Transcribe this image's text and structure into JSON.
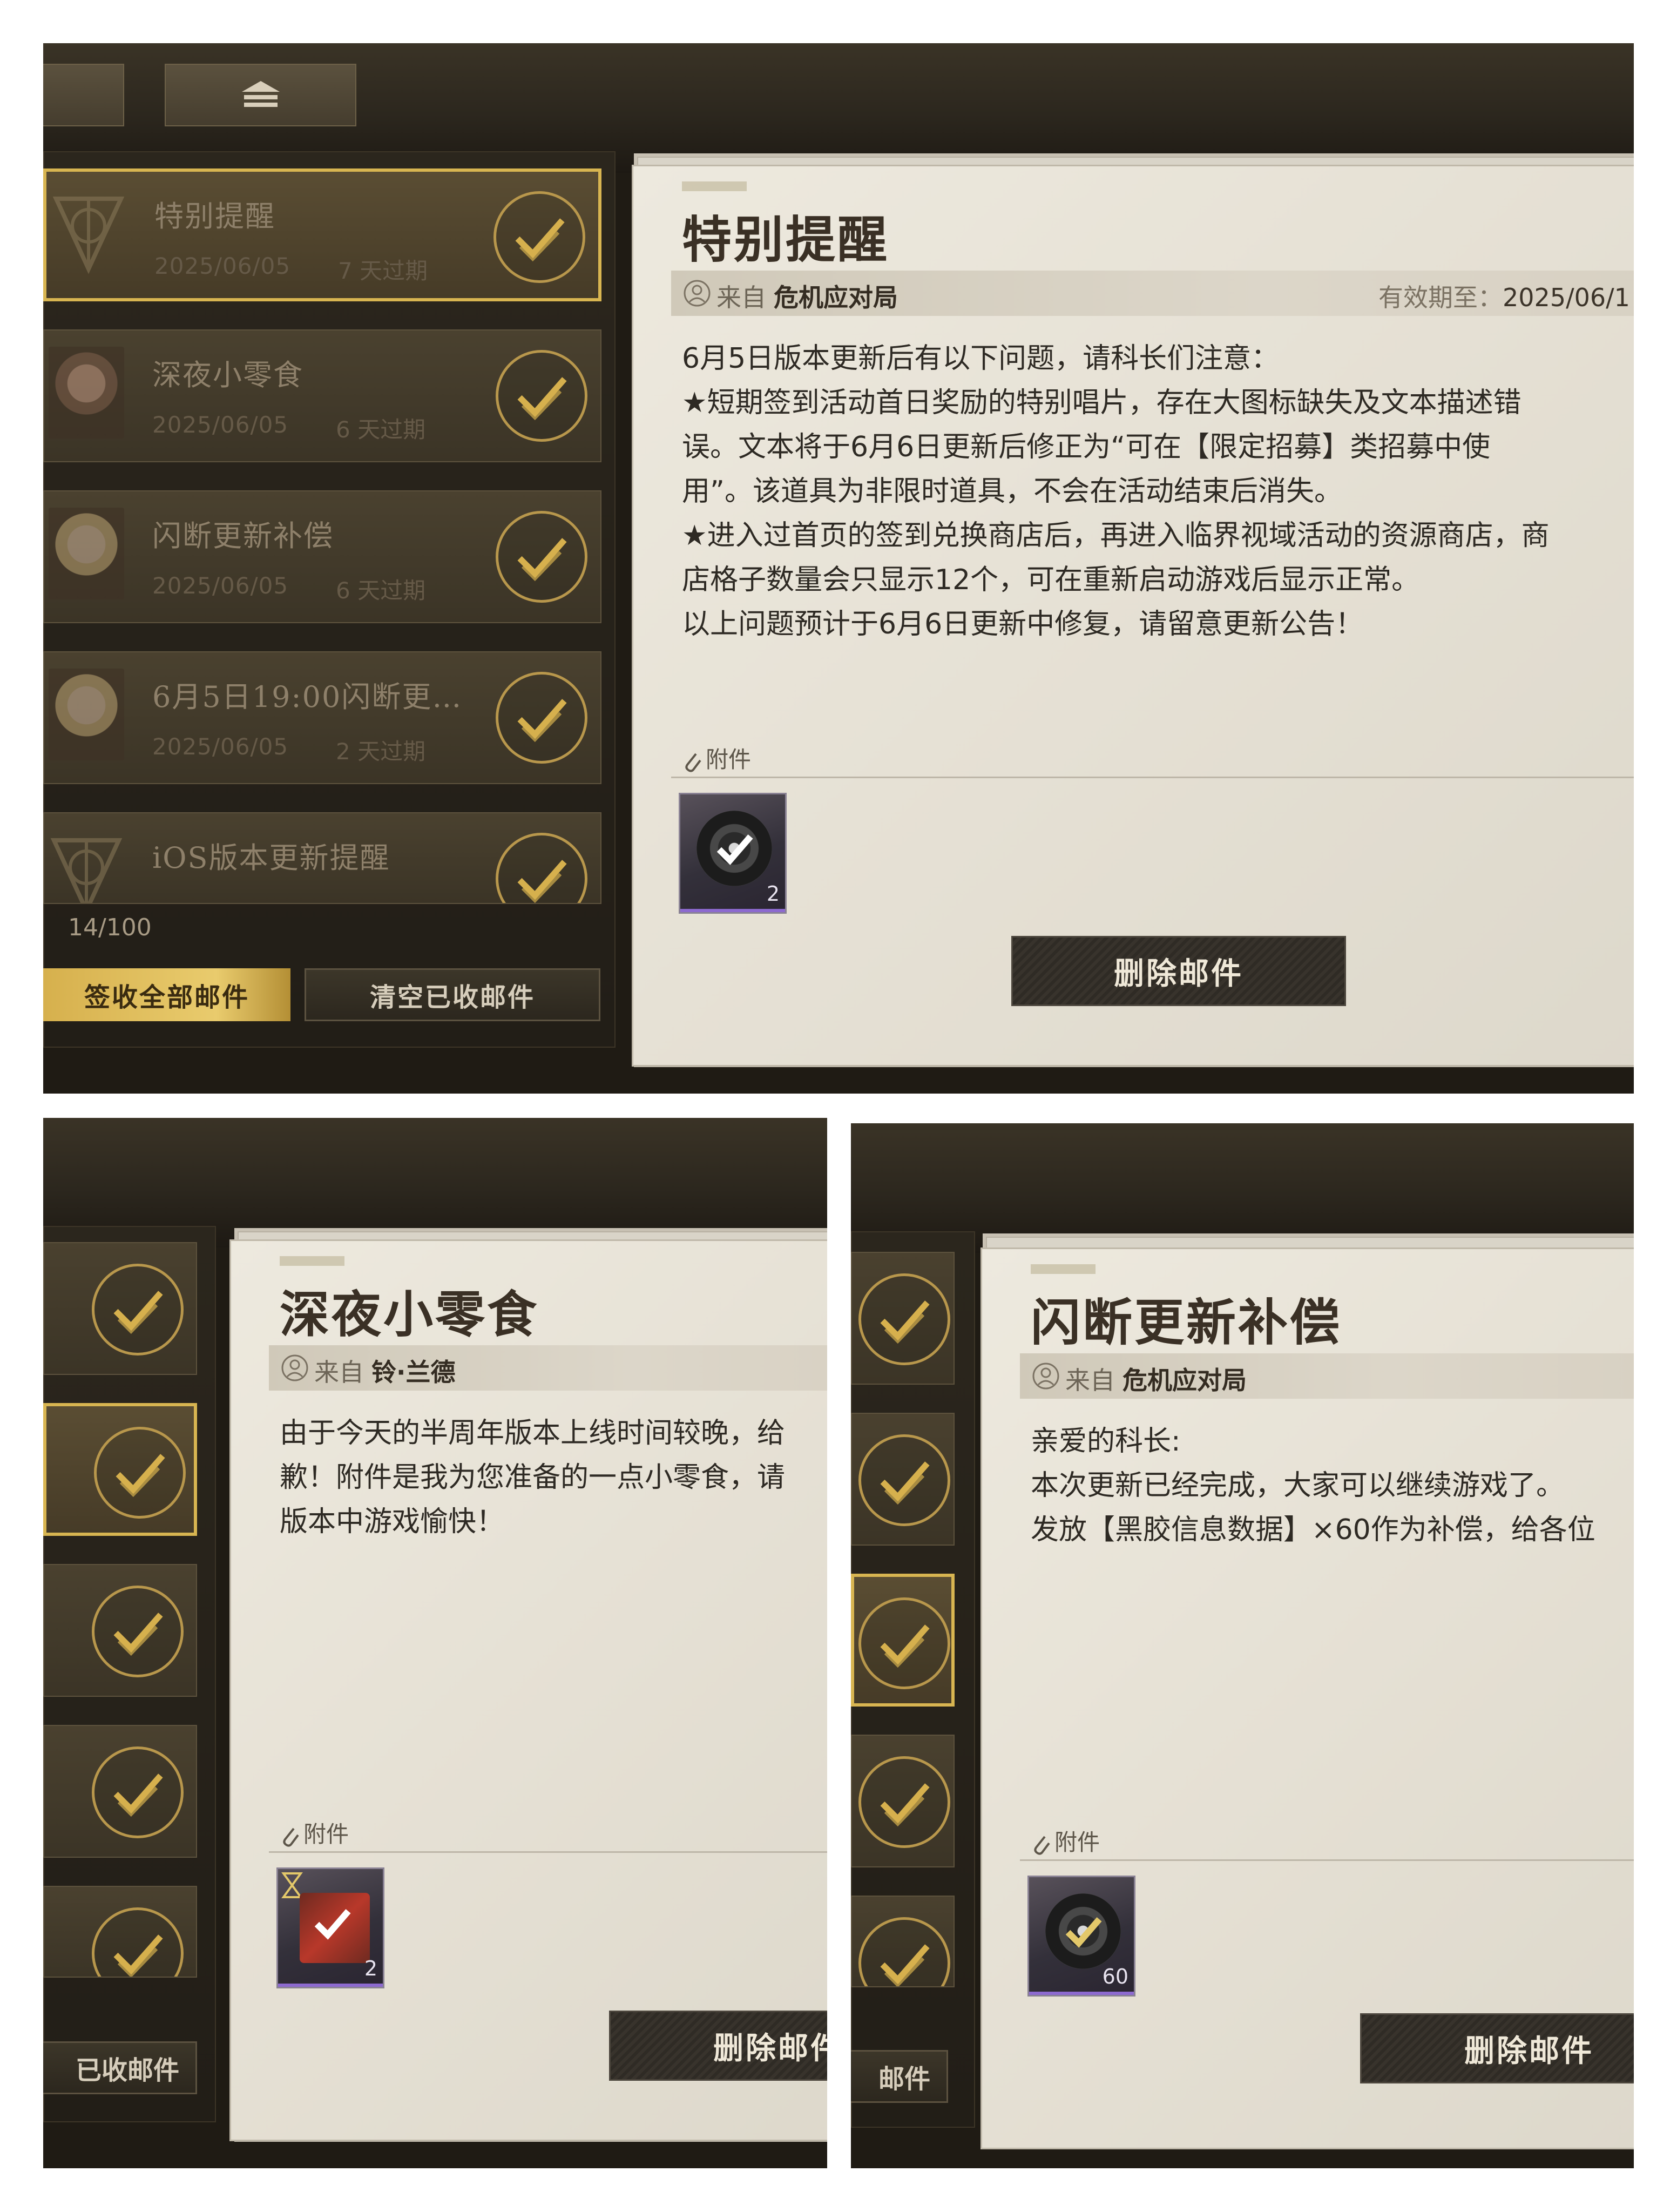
{
  "panels": [
    {
      "mail_list": [
        {
          "title": "特别提醒",
          "date": "2025/06/05",
          "expire": "7 天过期",
          "avatar": "emblem-icon",
          "selected": true
        },
        {
          "title": "深夜小零食",
          "date": "2025/06/05",
          "expire": "6 天过期",
          "avatar": "character-avatar",
          "selected": false
        },
        {
          "title": "闪断更新补偿",
          "date": "2025/06/05",
          "expire": "6 天过期",
          "avatar": "character-avatar",
          "selected": false
        },
        {
          "title": "6月5日19:00闪断更…",
          "date": "2025/06/05",
          "expire": "2 天过期",
          "avatar": "character-avatar",
          "selected": false
        },
        {
          "title": "iOS版本更新提醒",
          "date": "",
          "expire": "",
          "avatar": "emblem-icon",
          "selected": false
        }
      ],
      "counter": "14/100",
      "claim_all": "签收全部邮件",
      "clear_received": "清空已收邮件",
      "detail": {
        "title": "特别提醒",
        "from_label": "来自",
        "from_name": "危机应对局",
        "valid_label": "有效期至：",
        "valid_value": "2025/06/1",
        "body": [
          "6月5日版本更新后有以下问题，请科长们注意：",
          "★短期签到活动首日奖励的特别唱片，存在大图标缺失及文本描述错",
          "误。文本将于6月6日更新后修正为“可在【限定招募】类招募中使",
          "用”。该道具为非限时道具，不会在活动结束后消失。",
          "★进入过首页的签到兑换商店后，再进入临界视域活动的资源商店，商",
          "店格子数量会只显示12个，可在重新启动游戏后显示正常。",
          "以上问题预计于6月6日更新中修复，请留意更新公告！"
        ],
        "attachment_label": "附件",
        "attachment_qty": "2",
        "delete": "删除邮件"
      }
    },
    {
      "detail": {
        "title": "深夜小零食",
        "from_label": "来自",
        "from_name": "铃·兰德",
        "body": [
          "由于今天的半周年版本上线时间较晚，给",
          "歉！附件是我为您准备的一点小零食，请",
          "版本中游戏愉快！"
        ],
        "attachment_label": "附件",
        "attachment_qty": "2",
        "delete": "删除邮件"
      },
      "clear_received": "已收邮件"
    },
    {
      "detail": {
        "title": "闪断更新补偿",
        "from_label": "来自",
        "from_name": "危机应对局",
        "body": [
          "亲爱的科长:",
          "本次更新已经完成，大家可以继续游戏了。",
          "发放【黑胶信息数据】×60作为补偿，给各位"
        ],
        "attachment_label": "附件",
        "attachment_qty": "60",
        "delete": "删除邮件"
      },
      "clear_received": "邮件"
    }
  ],
  "colors": {
    "accent_gold": "#d8b551",
    "panel_dark": "#2b261d",
    "paper": "#e6e1d5"
  }
}
